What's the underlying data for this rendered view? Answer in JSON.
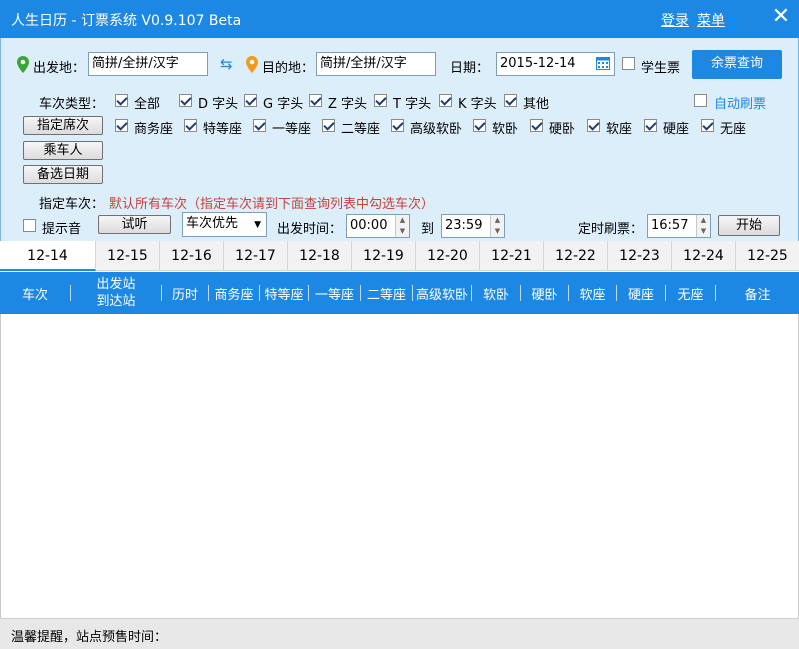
{
  "titlebar": {
    "title": "人生日历 - 订票系统 V0.9.107 Beta",
    "login": "登录",
    "menu": "菜单",
    "close": "✕"
  },
  "search": {
    "from_label": "出发地：",
    "from_value": "简拼/全拼/汉字",
    "swap": "⇆",
    "to_label": "目的地：",
    "to_value": "简拼/全拼/汉字",
    "date_label": "日期：",
    "date_value": "2015-12-14",
    "student_label": "学生票",
    "student_checked": false,
    "query_button": "余票查询"
  },
  "train_types": {
    "label": "车次类型：",
    "items": [
      {
        "label": "全部",
        "checked": true
      },
      {
        "label": "D 字头",
        "checked": true
      },
      {
        "label": "G 字头",
        "checked": true
      },
      {
        "label": "Z 字头",
        "checked": true
      },
      {
        "label": "T 字头",
        "checked": true
      },
      {
        "label": "K 字头",
        "checked": true
      },
      {
        "label": "其他",
        "checked": true
      }
    ],
    "auto_refresh": "自动刷票",
    "auto_refresh_checked": false
  },
  "seats": {
    "button": "指定席次",
    "items": [
      {
        "label": "商务座",
        "checked": true
      },
      {
        "label": "特等座",
        "checked": true
      },
      {
        "label": "一等座",
        "checked": true
      },
      {
        "label": "二等座",
        "checked": true
      },
      {
        "label": "高级软卧",
        "checked": true
      },
      {
        "label": "软卧",
        "checked": true
      },
      {
        "label": "硬卧",
        "checked": true
      },
      {
        "label": "软座",
        "checked": true
      },
      {
        "label": "硬座",
        "checked": true
      },
      {
        "label": "无座",
        "checked": true
      }
    ]
  },
  "passenger_button": "乘车人",
  "alt_date_button": "备选日期",
  "assign": {
    "label": "指定车次：",
    "hint": "默认所有车次（指定车次请到下面查询列表中勾选车次）"
  },
  "options": {
    "sound_label": "提示音",
    "sound_checked": false,
    "listen_button": "试听",
    "priority_value": "车次优先",
    "depart_label": "出发时间：",
    "time_from": "00:00",
    "to_label": "到",
    "time_to": "23:59",
    "timer_label": "定时刷票：",
    "timer_value": "16:57",
    "start_button": "开始"
  },
  "date_tabs": [
    "12-14",
    "12-15",
    "12-16",
    "12-17",
    "12-18",
    "12-19",
    "12-20",
    "12-21",
    "12-22",
    "12-23",
    "12-24",
    "12-25"
  ],
  "active_date_tab": 0,
  "table": {
    "columns": [
      "车次",
      "出发站",
      "到达站",
      "历时",
      "商务座",
      "特等座",
      "一等座",
      "二等座",
      "高级软卧",
      "软卧",
      "硬卧",
      "软座",
      "硬座",
      "无座",
      "备注"
    ]
  },
  "status": {
    "text": "温馨提醒，站点预售时间："
  },
  "colors": {
    "accent": "#1d87e4",
    "panel": "#ddeefb",
    "hint_red": "#c8413c",
    "pin_green": "#3aa635",
    "pin_orange": "#f39a1e"
  }
}
